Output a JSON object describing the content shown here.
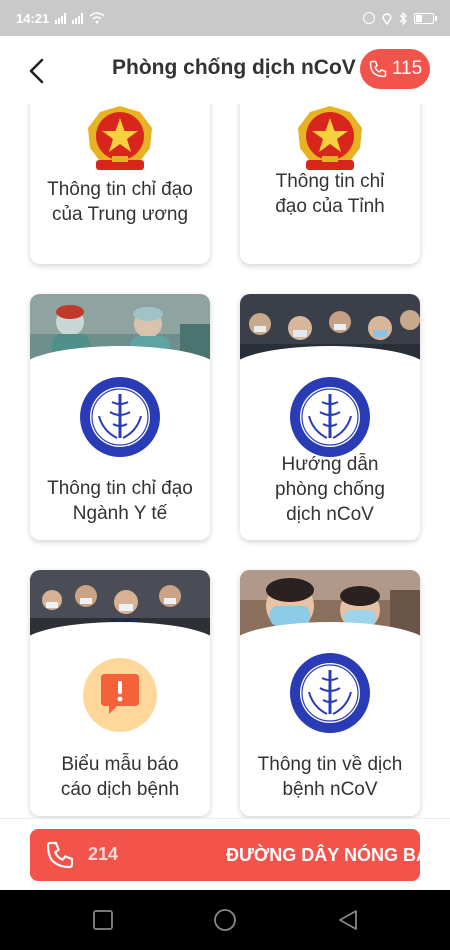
{
  "status_bar": {
    "time": "14:21"
  },
  "header": {
    "title": "Phòng chống dịch nCoV",
    "hotline_label": "115"
  },
  "cards": [
    {
      "label": "Thông tin chỉ đạo của Trung ương",
      "icon": "national-emblem-icon"
    },
    {
      "label": "Thông tin chỉ đạo của Tỉnh",
      "icon": "national-emblem-icon"
    },
    {
      "label": "Thông tin chỉ đạo Ngành Y tế",
      "icon": "health-department-seal-icon"
    },
    {
      "label": "Hướng dẫn phòng chống dịch nCoV",
      "icon": "health-department-seal-icon"
    },
    {
      "label": "Biểu mẫu báo cáo dịch bệnh",
      "icon": "report-alert-icon"
    },
    {
      "label": "Thông tin về dịch bệnh nCoV",
      "icon": "health-department-seal-icon"
    }
  ],
  "hotline_bar": {
    "number": "214",
    "text": "ĐƯỜNG DÂY NÓNG BA"
  },
  "colors": {
    "accent": "#f2534a",
    "seal_blue": "#2a3cb5",
    "emblem_red": "#d9261c",
    "emblem_gold": "#e8b322"
  }
}
